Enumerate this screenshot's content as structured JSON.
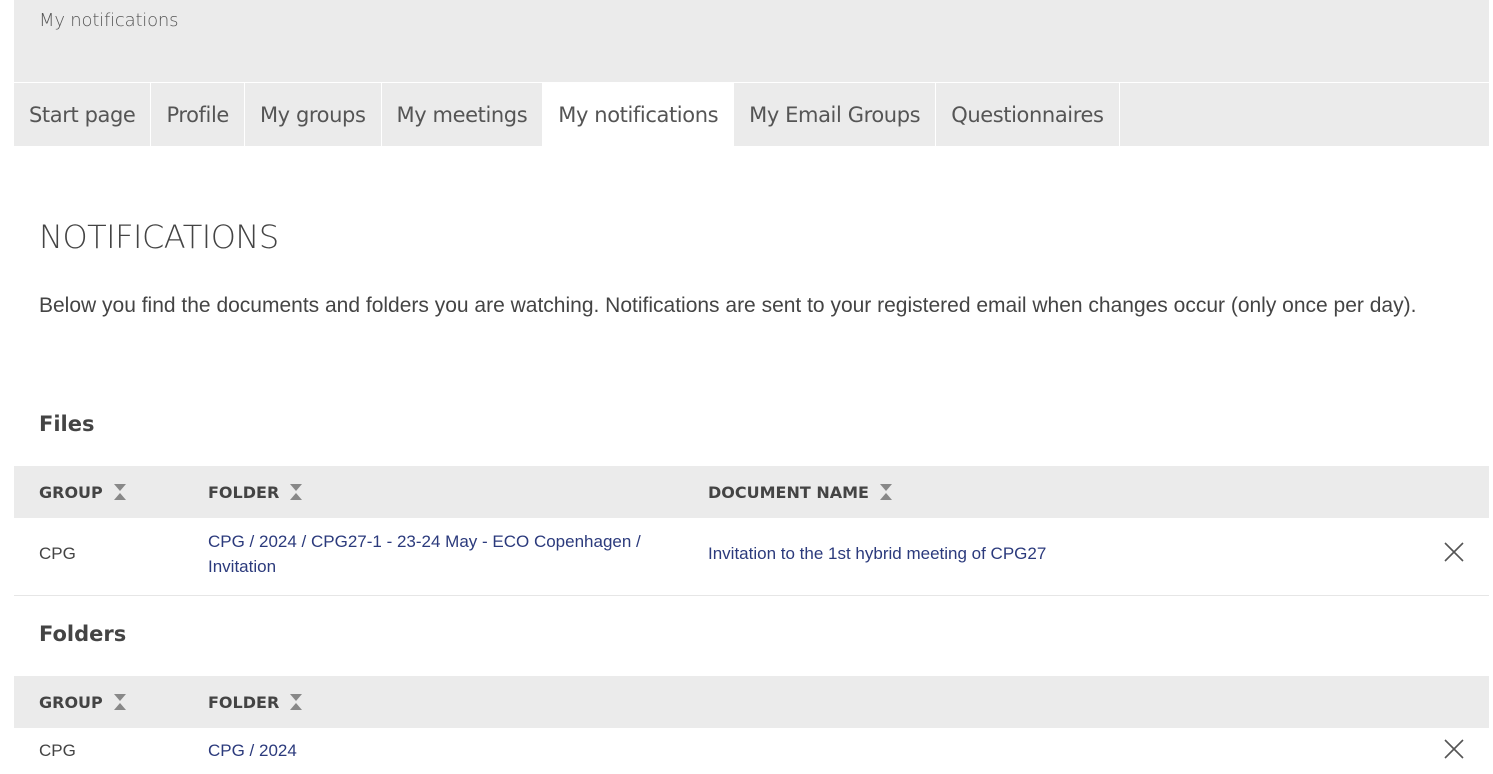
{
  "breadcrumb": "My notifications",
  "tabs": [
    {
      "label": "Start page",
      "active": false
    },
    {
      "label": "Profile",
      "active": false
    },
    {
      "label": "My groups",
      "active": false
    },
    {
      "label": "My meetings",
      "active": false
    },
    {
      "label": "My notifications",
      "active": true
    },
    {
      "label": "My Email Groups",
      "active": false
    },
    {
      "label": "Questionnaires",
      "active": false
    }
  ],
  "page": {
    "title": "NOTIFICATIONS",
    "intro": "Below you find the documents and folders you are watching. Notifications are sent to your registered email when changes occur (only once per day)."
  },
  "files": {
    "title": "Files",
    "columns": {
      "group": "GROUP",
      "folder": "FOLDER",
      "document": "DOCUMENT NAME"
    },
    "rows": [
      {
        "group": "CPG",
        "folder": "CPG / 2024 / CPG27-1 - 23-24 May - ECO Copenhagen / Invitation",
        "document": "Invitation to the 1st hybrid meeting of CPG27"
      }
    ]
  },
  "folders": {
    "title": "Folders",
    "columns": {
      "group": "GROUP",
      "folder": "FOLDER"
    },
    "rows": [
      {
        "group": "CPG",
        "folder": "CPG / 2024"
      }
    ]
  },
  "icons": {
    "sort": "sort-icon",
    "remove": "close-icon"
  },
  "colors": {
    "band": "#ebebeb",
    "link": "#2b3a7c",
    "text": "#444444"
  }
}
